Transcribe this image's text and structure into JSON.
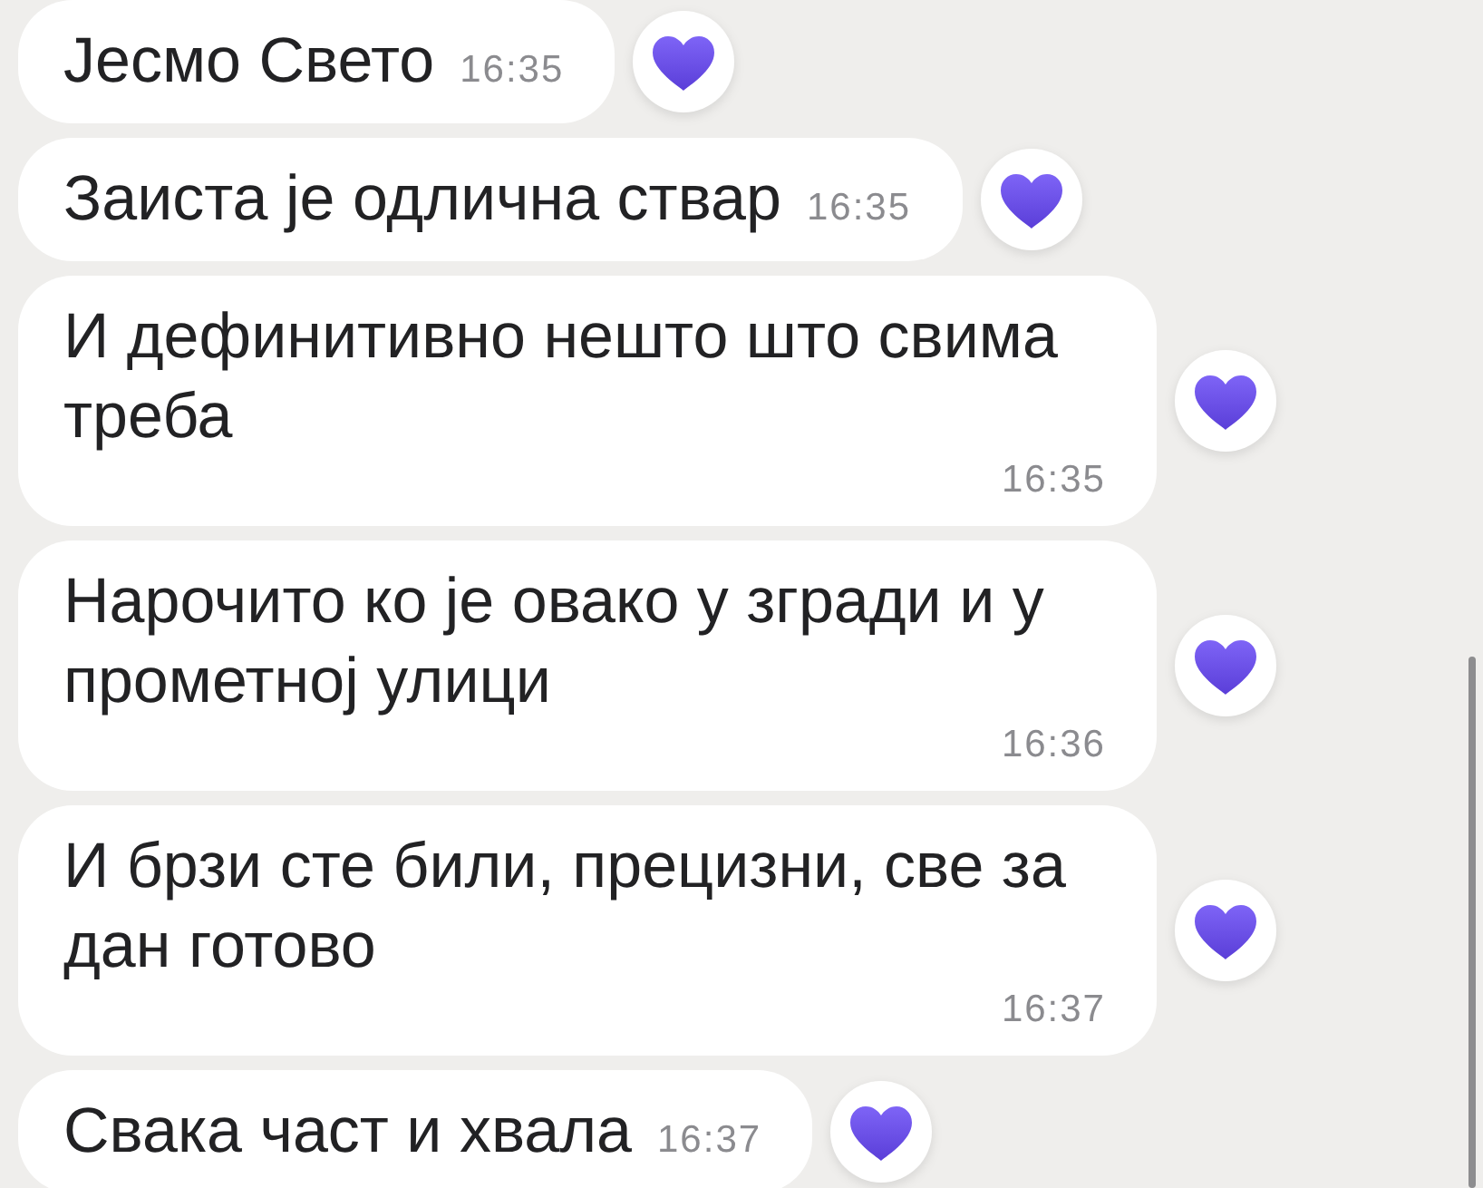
{
  "messages": [
    {
      "text": "Јесмо Свето",
      "time": "16:35",
      "reacted": true
    },
    {
      "text": "Заиста је одлична ствар",
      "time": "16:35",
      "reacted": true
    },
    {
      "text": "И дефинитивно нешто што свима треба",
      "time": "16:35",
      "reacted": true
    },
    {
      "text": "Нарочито ко је овако у згради и у прометној улици",
      "time": "16:36",
      "reacted": true
    },
    {
      "text": "И брзи сте били, прецизни, све за дан готово",
      "time": "16:37",
      "reacted": true
    },
    {
      "text": "Свака част и хвала",
      "time": "16:37",
      "reacted": true
    }
  ]
}
